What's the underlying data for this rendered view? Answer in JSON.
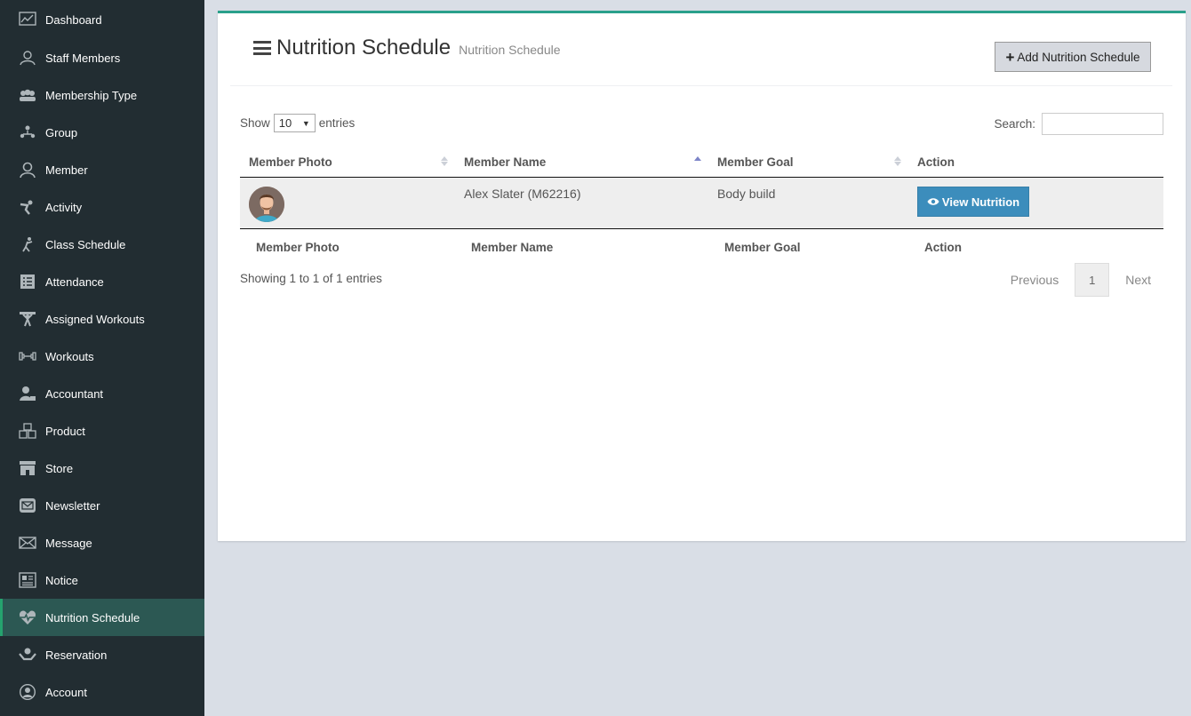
{
  "sidebar": {
    "items": [
      {
        "label": "Dashboard",
        "icon": "dashboard-icon"
      },
      {
        "label": "Staff Members",
        "icon": "staff-icon"
      },
      {
        "label": "Membership Type",
        "icon": "membership-icon"
      },
      {
        "label": "Group",
        "icon": "group-icon"
      },
      {
        "label": "Member",
        "icon": "member-icon"
      },
      {
        "label": "Activity",
        "icon": "activity-icon"
      },
      {
        "label": "Class Schedule",
        "icon": "class-schedule-icon"
      },
      {
        "label": "Attendance",
        "icon": "attendance-icon"
      },
      {
        "label": "Assigned Workouts",
        "icon": "assigned-workouts-icon"
      },
      {
        "label": "Workouts",
        "icon": "dumbbell-icon"
      },
      {
        "label": "Accountant",
        "icon": "accountant-icon"
      },
      {
        "label": "Product",
        "icon": "product-icon"
      },
      {
        "label": "Store",
        "icon": "store-icon"
      },
      {
        "label": "Newsletter",
        "icon": "newsletter-icon"
      },
      {
        "label": "Message",
        "icon": "envelope-icon"
      },
      {
        "label": "Notice",
        "icon": "notice-icon"
      },
      {
        "label": "Nutrition Schedule",
        "icon": "heartbeat-icon",
        "active": true
      },
      {
        "label": "Reservation",
        "icon": "reservation-icon"
      },
      {
        "label": "Account",
        "icon": "account-icon"
      }
    ]
  },
  "header": {
    "title": "Nutrition Schedule",
    "subtitle": "Nutrition Schedule",
    "add_button": "Add Nutrition Schedule"
  },
  "controls": {
    "show_label": "Show",
    "entries_value": "10",
    "entries_label": "entries",
    "search_label": "Search:",
    "search_value": ""
  },
  "table": {
    "columns": [
      "Member Photo",
      "Member Name",
      "Member Goal",
      "Action"
    ],
    "rows": [
      {
        "member_name": "Alex Slater (M62216)",
        "member_goal": "Body build",
        "action_label": "View Nutrition"
      }
    ],
    "footer": [
      "Member Photo",
      "Member Name",
      "Member Goal",
      "Action"
    ]
  },
  "pagination": {
    "info": "Showing 1 to 1 of 1 entries",
    "previous": "Previous",
    "page": "1",
    "next": "Next"
  },
  "colors": {
    "sidebar_bg": "#222d32",
    "active_bg": "#2c5853",
    "accent": "#2aa08b",
    "primary_button": "#3c8dbc"
  }
}
